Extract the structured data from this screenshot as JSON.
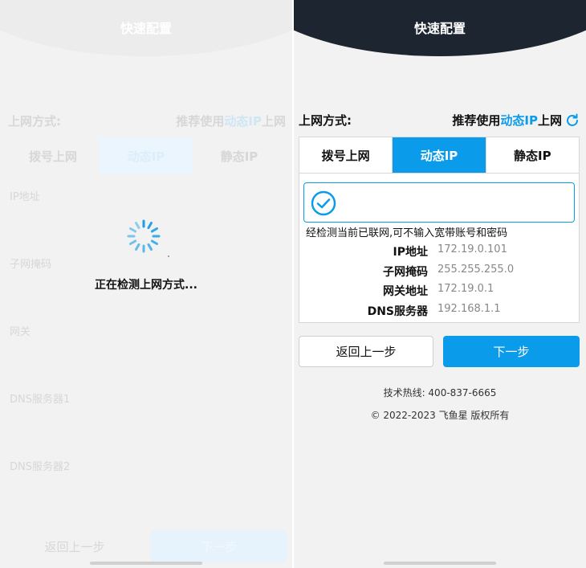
{
  "left_screen": {
    "title": "快速配置",
    "connection_label": "上网方式:",
    "recommend_prefix": "推荐使用",
    "recommend_mode": "动态IP",
    "recommend_suffix": "上网",
    "tabs": [
      "拨号上网",
      "动态IP",
      "静态IP"
    ],
    "fields": [
      "IP地址",
      "子网掩码",
      "网关",
      "DNS服务器1",
      "DNS服务器2"
    ],
    "back_label": "返回上一步",
    "next_label": "下一步",
    "loading_text": "正在检测上网方式..."
  },
  "right_screen": {
    "title": "快速配置",
    "connection_label": "上网方式:",
    "recommend_prefix": "推荐使用",
    "recommend_mode": "动态IP",
    "recommend_suffix": "上网",
    "tabs": [
      {
        "label": "拨号上网",
        "active": false
      },
      {
        "label": "动态IP",
        "active": true
      },
      {
        "label": "静态IP",
        "active": false
      }
    ],
    "notice": "经检测当前已联网,可不输入宽带账号和密码",
    "info": {
      "ip_label": "IP地址",
      "ip_value": "172.19.0.101",
      "mask_label": "子网掩码",
      "mask_value": "255.255.255.0",
      "gateway_label": "网关地址",
      "gateway_value": "172.19.0.1",
      "dns_label": "DNS服务器",
      "dns_value": "192.168.1.1"
    },
    "back_label": "返回上一步",
    "next_label": "下一步",
    "hotline": "技术热线: 400-837-6665",
    "copyright": "© 2022-2023 飞鱼星 版权所有"
  },
  "icons": {
    "status": "checkmark-circle-icon",
    "refresh": "refresh-icon",
    "loading": "spinner-icon"
  },
  "colors": {
    "accent": "#0a9bea",
    "header_dark": "#1d2530"
  }
}
